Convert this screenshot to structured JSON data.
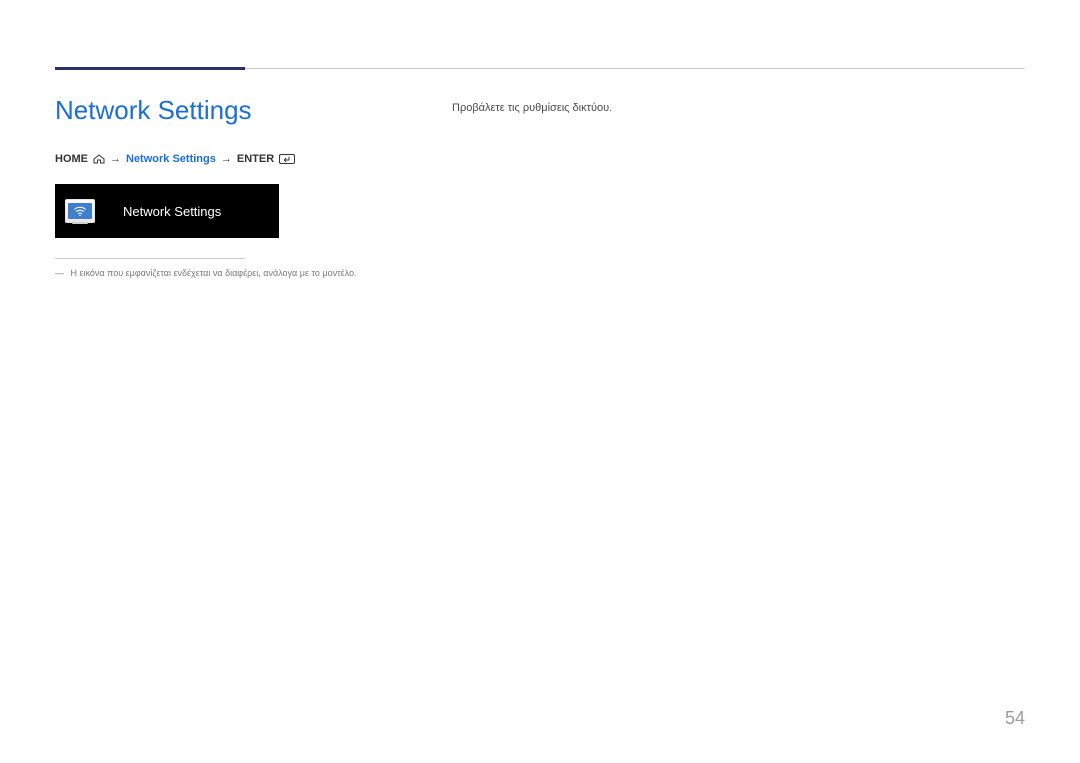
{
  "title": "Network Settings",
  "breadcrumb": {
    "home": "HOME",
    "item": "Network Settings",
    "enter": "ENTER"
  },
  "tile": {
    "label": "Network Settings"
  },
  "footnote": "Η εικόνα που εμφανίζεται ενδέχεται να διαφέρει, ανάλογα με το μοντέλο.",
  "description": "Προβάλετε τις ρυθμίσεις δικτύου.",
  "page_number": "54"
}
